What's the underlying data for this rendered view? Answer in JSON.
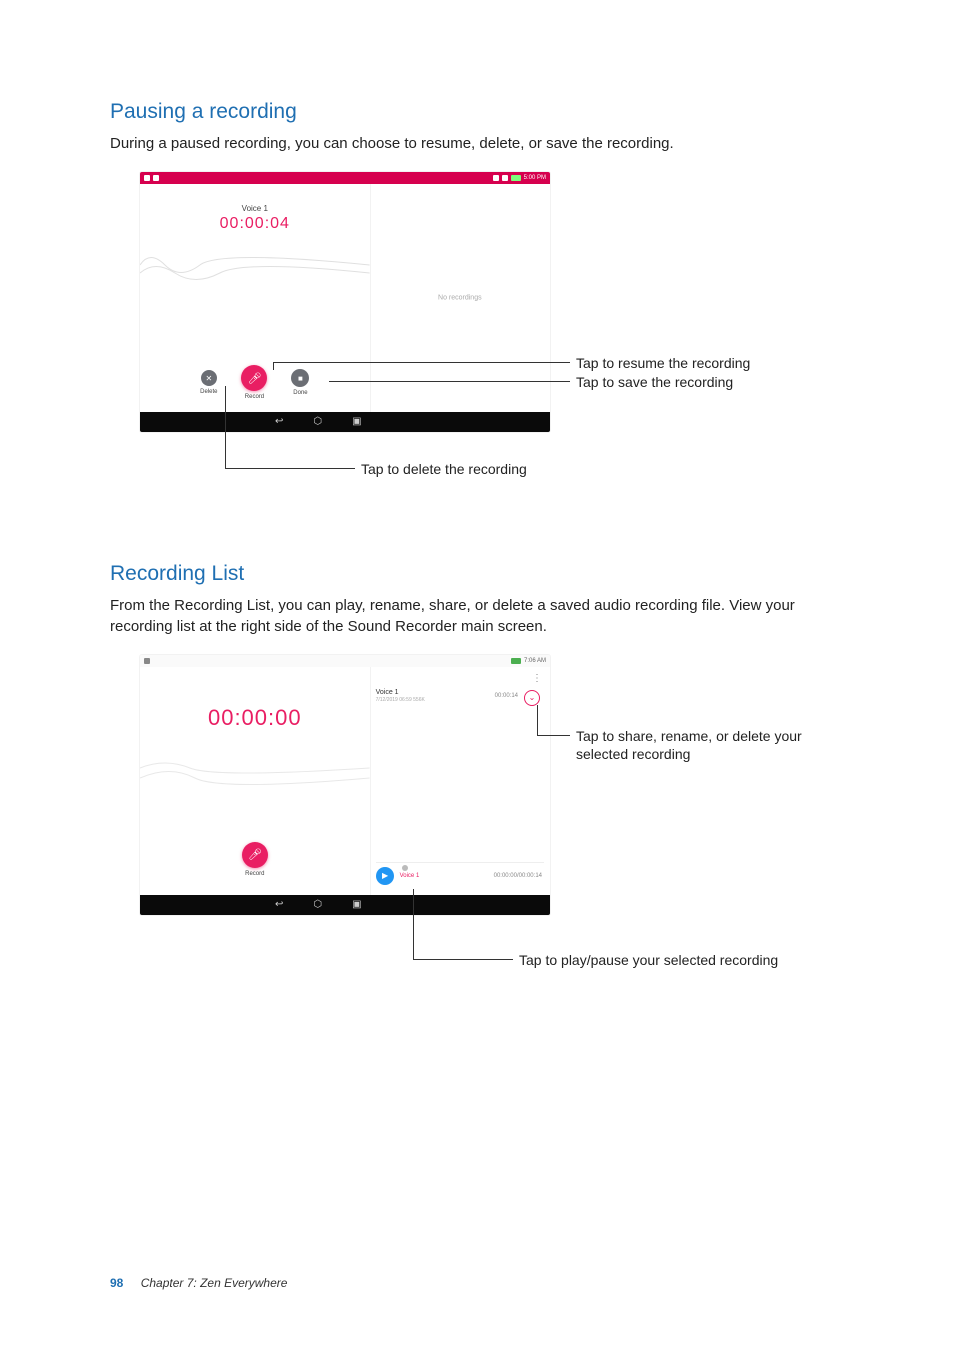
{
  "section1": {
    "heading": "Pausing a recording",
    "body": "During a paused recording, you can choose to resume, delete, or save the recording."
  },
  "section2": {
    "heading": "Recording List",
    "body": "From the Recording List, you can play, rename, share, or delete a saved audio recording file. View your recording list at the right side of the Sound Recorder main screen."
  },
  "shot1": {
    "status_time": "5:00 PM",
    "rec_title": "Voice 1",
    "rec_timer": "00:00:04",
    "empty_list": "No recordings",
    "btn_delete": "Delete",
    "btn_record": "Record",
    "btn_done": "Done"
  },
  "shot2": {
    "status_time": "7:06 AM",
    "rec_timer": "00:00:00",
    "btn_record": "Record",
    "item_name": "Voice 1",
    "item_meta": "7/12/2019 06:59  556K",
    "item_dur": "00:00:14",
    "player_name": "Voice 1",
    "player_time": "00:00:00/00:00:14"
  },
  "callouts": {
    "c1_resume": "Tap to resume the recording",
    "c1_save": "Tap to save the recording",
    "c1_delete": "Tap to delete the recording",
    "c2_share": "Tap to share, rename, or delete your selected recording",
    "c2_play": "Tap to play/pause your selected recording"
  },
  "footer": {
    "page_number": "98",
    "chapter": "Chapter 7: Zen Everywhere"
  }
}
